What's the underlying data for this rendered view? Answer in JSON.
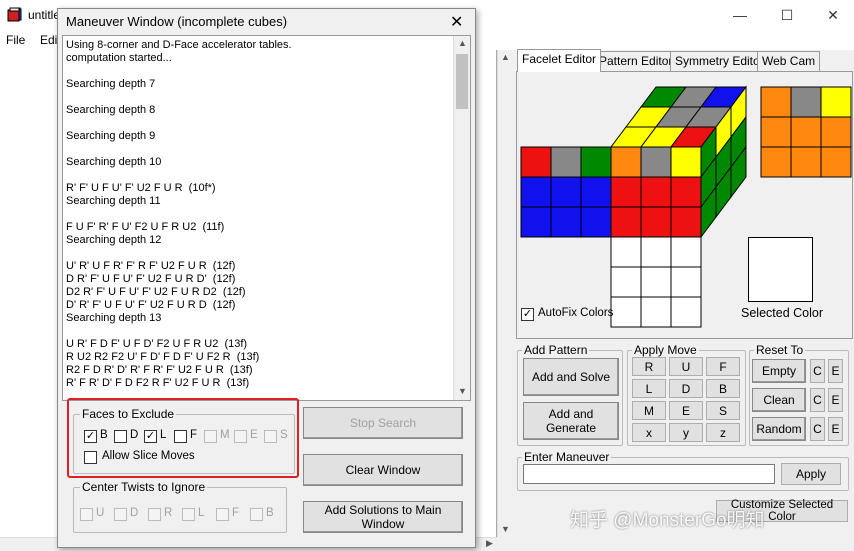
{
  "main_window": {
    "title": "untitle",
    "menu": [
      "File",
      "Edit"
    ],
    "controls": {
      "minimize": "—",
      "maximize": "☐",
      "close": "✕"
    }
  },
  "tabs": [
    {
      "label": "Facelet Editor",
      "active": true
    },
    {
      "label": "Pattern Editor",
      "active": false
    },
    {
      "label": "Symmetry Editor",
      "active": false
    },
    {
      "label": "Web Cam",
      "active": false
    }
  ],
  "facelet_editor": {
    "autofix_label": "AutoFix Colors",
    "autofix_checked": true,
    "selected_color_label": "Selected Color",
    "selected_color": "#ffffff",
    "colors": {
      "red": "#ee1111",
      "green": "#008800",
      "blue": "#1111ee",
      "yellow": "#ffff00",
      "orange": "#ff8811",
      "gray": "#888888",
      "white": "#ffffff"
    }
  },
  "add_pattern": {
    "legend": "Add Pattern",
    "add_and_solve": "Add and Solve",
    "add_and_generate": "Add and Generate"
  },
  "apply_move": {
    "legend": "Apply Move",
    "moves": [
      [
        "R",
        "U",
        "F"
      ],
      [
        "L",
        "D",
        "B"
      ],
      [
        "M",
        "E",
        "S"
      ],
      [
        "x",
        "y",
        "z"
      ]
    ]
  },
  "reset_to": {
    "legend": "Reset To",
    "rows": [
      {
        "label": "Empty"
      },
      {
        "label": "Clean"
      },
      {
        "label": "Random"
      }
    ],
    "c_label": "C",
    "e_label": "E"
  },
  "enter_maneuver": {
    "legend": "Enter Maneuver",
    "value": "",
    "apply_label": "Apply"
  },
  "customize_button": "Customize Selected Color",
  "watermark": "知乎 @MonsterGo明知",
  "maneuver_window": {
    "title": "Maneuver Window (incomplete cubes)",
    "close": "✕",
    "output_lines": [
      "Using 8-corner and D-Face accelerator tables.",
      "computation started...",
      "",
      "Searching depth 7",
      "",
      "Searching depth 8",
      "",
      "Searching depth 9",
      "",
      "Searching depth 10",
      "",
      "R' F' U F U' F' U2 F U R  (10f*)",
      "Searching depth 11",
      "",
      "F U F' R' F U' F2 U F R U2  (11f)",
      "Searching depth 12",
      "",
      "U' R' U F R' F' R F' U2 F U R  (12f)",
      "D R' F' U F U' F' U2 F U R D'  (12f)",
      "D2 R' F' U F U' F' U2 F U R D2  (12f)",
      "D' R' F' U F U' F' U2 F U R D  (12f)",
      "Searching depth 13",
      "",
      "U R' F D F' U F D' F2 U F R U2  (13f)",
      "R U2 R2 F2 U' F D' F D F' U F2 R  (13f)",
      "R2 F D R' D' R' F R' F' U2 F U R  (13f)",
      "R' F R' D' F D F2 R F' U2 F U R  (13f)"
    ],
    "faces_to_exclude": {
      "legend": "Faces to Exclude",
      "faces": [
        {
          "label": "B",
          "checked": true,
          "enabled": true
        },
        {
          "label": "D",
          "checked": false,
          "enabled": true
        },
        {
          "label": "L",
          "checked": true,
          "enabled": true
        },
        {
          "label": "F",
          "checked": false,
          "enabled": true
        },
        {
          "label": "M",
          "checked": false,
          "enabled": false
        },
        {
          "label": "E",
          "checked": false,
          "enabled": false
        },
        {
          "label": "S",
          "checked": false,
          "enabled": false
        }
      ],
      "allow_slice_moves": "Allow Slice Moves"
    },
    "center_twists": {
      "legend": "Center Twists to Ignore",
      "faces": [
        "U",
        "D",
        "R",
        "L",
        "F",
        "B"
      ]
    },
    "buttons": {
      "stop_search": "Stop Search",
      "clear_window": "Clear Window",
      "add_solutions": "Add Solutions to Main Window"
    }
  }
}
